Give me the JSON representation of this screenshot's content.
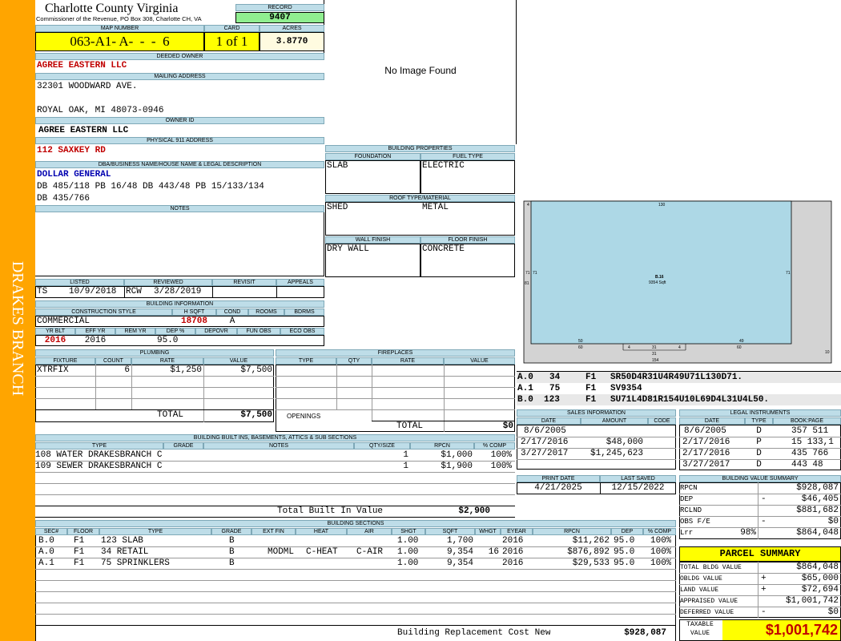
{
  "side_label": "DRAKES BRANCH",
  "colors": {
    "orange": "#ffa500",
    "yellow": "#ffff00",
    "header_blue": "#bedde8",
    "record_green": "#90ee90",
    "sketch_blue": "#add8e6",
    "red": "#c00000",
    "navy": "#0000b0"
  },
  "header": {
    "county": "Charlotte County Virginia",
    "address": "Commissioner of the Revenue, PO Box 308, Charlotte CH, VA",
    "record_label": "RECORD",
    "record": "9407",
    "map_label": "MAP NUMBER",
    "map_number": "063-A1- A-  -  -  6",
    "card_label": "CARD",
    "card": "1 of 1",
    "acres_label": "ACRES",
    "acres": "3.8770"
  },
  "owner": {
    "deeded_label": "DEEDED OWNER",
    "deeded": "AGREE EASTERN LLC",
    "mailing_label": "MAILING ADDRESS",
    "mail_line1": "32301 WOODWARD AVE.",
    "mail_line2": "ROYAL OAK, MI 48073-0946",
    "owner_id_label": "OWNER ID",
    "owner_id": "AGREE EASTERN LLC",
    "physical_label": "PHYSICAL 911 ADDRESS",
    "physical": "112 SAXKEY RD",
    "dba_label": "DBA/BUSINESS NAME/HOUSE NAME & LEGAL DESCRIPTION",
    "dba": "DOLLAR GENERAL",
    "legal1": "DB 485/118 PB 16/48 DB 443/48 PB 15/133/134",
    "legal2": "DB 435/766",
    "notes_label": "NOTES"
  },
  "image": {
    "text": "No Image Found"
  },
  "building_props": {
    "title": "BUILDING PROPERTIES",
    "foundation_label": "FOUNDATION",
    "foundation": "SLAB",
    "fuel_label": "FUEL TYPE",
    "fuel": "ELECTRIC",
    "roof_label": "ROOF TYPE/MATERIAL",
    "roof_type": "SHED",
    "roof_material": "METAL",
    "wall_label": "WALL FINISH",
    "wall": "DRY WALL",
    "floor_label": "FLOOR FINISH",
    "floor": "CONCRETE"
  },
  "review": {
    "listed_label": "LISTED",
    "listed_by": "TS",
    "listed_date": "10/9/2018",
    "reviewed_label": "REVIEWED",
    "reviewed_by": "RCW",
    "reviewed_date": "3/28/2019",
    "revisit_label": "REVISIT",
    "appeals_label": "APPEALS"
  },
  "building_info": {
    "title": "BUILDING INFORMATION",
    "style_label": "CONSTRUCTION STYLE",
    "style": "COMMERCIAL",
    "hsqft_label": "H SQFT",
    "hsqft": "18708",
    "cond_label": "COND",
    "cond": "A",
    "rooms_label": "ROOMS",
    "bdrms_label": "BDRMS",
    "yrblt_label": "YR BLT",
    "yrblt": "2016",
    "effyr_label": "EFF YR",
    "effyr": "2016",
    "remyr_label": "REM YR",
    "dep_label": "DEP %",
    "dep": "95.0",
    "depovr_label": "DEPOVR",
    "funobs_label": "FUN OBS",
    "ecoobs_label": "ECO OBS"
  },
  "plumbing": {
    "title": "PLUMBING",
    "headers": [
      "FIXTURE",
      "COUNT",
      "RATE",
      "VALUE"
    ],
    "rows": [
      {
        "fixture": "XTRFIX",
        "count": "6",
        "rate": "$1,250",
        "value": "$7,500"
      }
    ],
    "total_label": "TOTAL",
    "total": "$7,500"
  },
  "fireplaces": {
    "title": "FIREPLACES",
    "headers": [
      "TYPE",
      "QTY",
      "RATE",
      "VALUE"
    ],
    "openings_label": "OPENINGS",
    "total_label": "TOTAL",
    "total": "$0"
  },
  "sketch": {
    "labels": [
      "130",
      "71",
      "71",
      "81",
      "71",
      "B.16",
      "9354 Sqft",
      "50",
      "60",
      "49",
      "60",
      "4",
      "31",
      "4",
      "31",
      "154",
      "4",
      "10"
    ],
    "legend": [
      {
        "code": "A.0",
        "area": "34",
        "floor": "F1",
        "desc": "SR50D4R31U4R49U71L130D71."
      },
      {
        "code": "A.1",
        "area": "75",
        "floor": "F1",
        "desc": "SV9354"
      },
      {
        "code": "B.0",
        "area": "123",
        "floor": "F1",
        "desc": "SU71L4D81R154U10L69D4L31U4L50."
      }
    ]
  },
  "built_ins": {
    "title": "BUILDING BUILT INS, BASEMENTS, ATTICS & SUB SECTIONS",
    "headers": [
      "TYPE",
      "GRADE",
      "NOTES",
      "QTY/SIZE",
      "RPCN",
      "% COMP"
    ],
    "rows": [
      {
        "type": "108 WATER DRAKESBRANCH C",
        "grade": "",
        "notes": "",
        "qty": "1",
        "rpcn": "$1,000",
        "comp": "100%"
      },
      {
        "type": "109 SEWER DRAKESBRANCH C",
        "grade": "",
        "notes": "",
        "qty": "1",
        "rpcn": "$1,900",
        "comp": "100%"
      }
    ],
    "total_label": "Total Built In Value",
    "total": "$2,900"
  },
  "sales": {
    "title": "SALES INFORMATION",
    "headers": [
      "DATE",
      "AMOUNT",
      "CODE"
    ],
    "rows": [
      {
        "date": "8/6/2005",
        "amount": "",
        "code": ""
      },
      {
        "date": "2/17/2016",
        "amount": "$48,000",
        "code": ""
      },
      {
        "date": "3/27/2017",
        "amount": "$1,245,623",
        "code": ""
      }
    ]
  },
  "legal": {
    "title": "LEGAL INSTRUMENTS",
    "headers": [
      "DATE",
      "TYPE",
      "BOOK:PAGE"
    ],
    "rows": [
      {
        "date": "8/6/2005",
        "type": "D",
        "book": "357 511"
      },
      {
        "date": "2/17/2016",
        "type": "P",
        "book": "15 133,1"
      },
      {
        "date": "2/17/2016",
        "type": "D",
        "book": "435 766"
      },
      {
        "date": "3/27/2017",
        "type": "D",
        "book": "443 48"
      }
    ]
  },
  "print": {
    "print_label": "PRINT DATE",
    "print_date": "4/21/2025",
    "saved_label": "LAST SAVED",
    "saved_date": "12/15/2022"
  },
  "value_summary": {
    "title": "BUILDING VALUE SUMMARY",
    "rows": [
      {
        "label": "RPCN",
        "sign": "",
        "pct": "",
        "value": "$928,087"
      },
      {
        "label": "DEP",
        "sign": "-",
        "pct": "",
        "value": "$46,405"
      },
      {
        "label": "RCLND",
        "sign": "",
        "pct": "",
        "value": "$881,682"
      },
      {
        "label": "OBS F/E",
        "sign": "-",
        "pct": "",
        "value": "$0"
      },
      {
        "label": "Lrr",
        "sign": "",
        "pct": "98%",
        "value": "$864,048"
      }
    ]
  },
  "sections": {
    "title": "BUILDING SECTIONS",
    "headers": [
      "SEC#",
      "FLOOR",
      "TYPE",
      "GRADE",
      "EXT FIN",
      "HEAT",
      "AIR",
      "SHGT",
      "SQFT",
      "WHGT",
      "EYEAR",
      "RPCN",
      "DEP",
      "% COMP"
    ],
    "rows": [
      {
        "sec": "B.0",
        "floor": "F1",
        "type": "123 SLAB",
        "grade": "B",
        "ext": "",
        "heat": "",
        "air": "",
        "shgt": "1.00",
        "sqft": "1,700",
        "whgt": "",
        "eyear": "2016",
        "rpcn": "$11,262",
        "dep": "95.0",
        "comp": "100%"
      },
      {
        "sec": "A.0",
        "floor": "F1",
        "type": "34 RETAIL",
        "grade": "B",
        "ext": "MODML",
        "heat": "C-HEAT",
        "air": "C-AIR",
        "shgt": "1.00",
        "sqft": "9,354",
        "whgt": "16",
        "eyear": "2016",
        "rpcn": "$876,892",
        "dep": "95.0",
        "comp": "100%"
      },
      {
        "sec": "A.1",
        "floor": "F1",
        "type": "75 SPRINKLERS",
        "grade": "B",
        "ext": "",
        "heat": "",
        "air": "",
        "shgt": "1.00",
        "sqft": "9,354",
        "whgt": "",
        "eyear": "2016",
        "rpcn": "$29,533",
        "dep": "95.0",
        "comp": "100%"
      }
    ],
    "total_label": "Building Replacement Cost New",
    "total": "$928,087"
  },
  "parcel": {
    "title": "PARCEL SUMMARY",
    "rows": [
      {
        "label": "TOTAL BLDG VALUE",
        "sign": "",
        "value": "$864,048"
      },
      {
        "label": "OBLDG VALUE",
        "sign": "+",
        "value": "$65,000"
      },
      {
        "label": "LAND VALUE",
        "sign": "+",
        "value": "$72,694"
      },
      {
        "label": "APPRAISED VALUE",
        "sign": "",
        "value": "$1,001,742"
      },
      {
        "label": "DEFERRED VALUE",
        "sign": "-",
        "value": "$0"
      }
    ],
    "taxable_label1": "TAXABLE",
    "taxable_label2": "VALUE",
    "taxable": "$1,001,742"
  }
}
